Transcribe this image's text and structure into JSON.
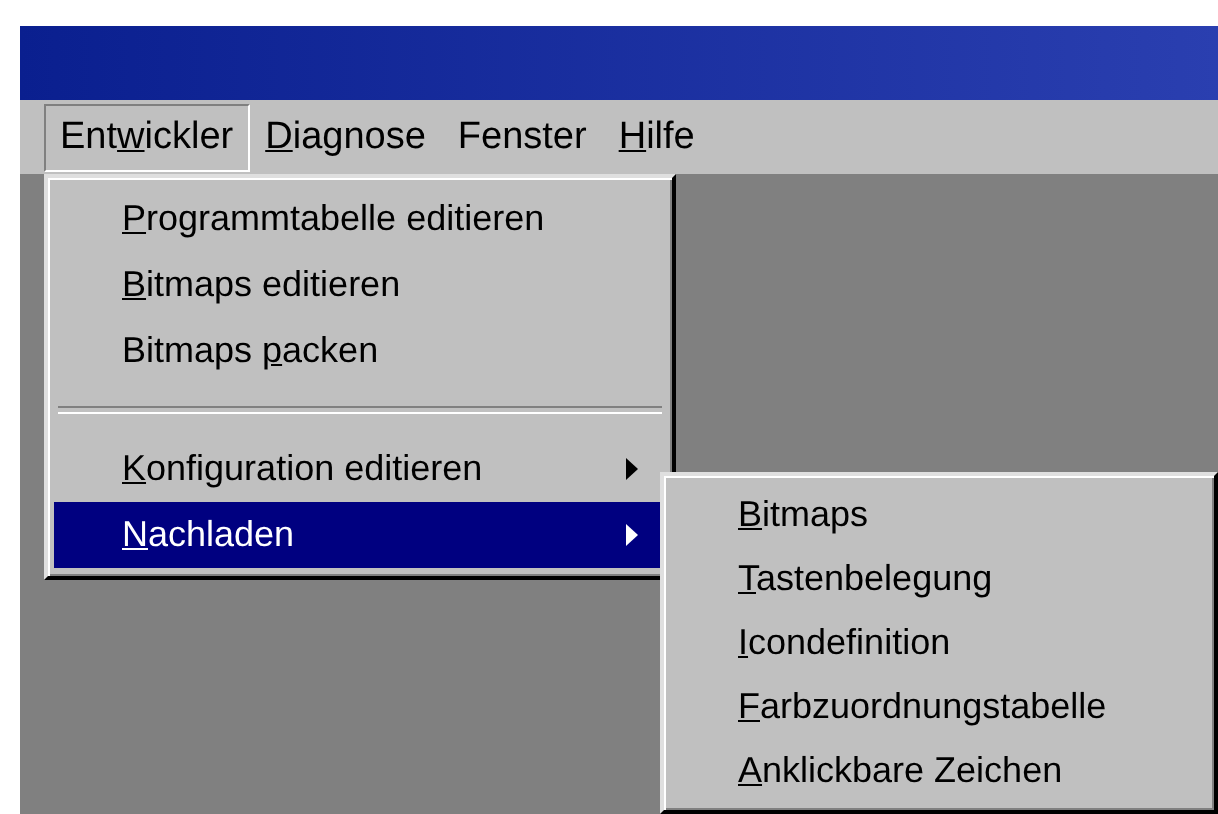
{
  "menu_bar": [
    {
      "pre": "Ent",
      "key": "w",
      "post": "ickler",
      "open": true
    },
    {
      "key": "D",
      "post": "iagnose",
      "open": false
    },
    {
      "pre": "Fenster",
      "open": false
    },
    {
      "key": "H",
      "post": "ilfe",
      "open": false
    }
  ],
  "dropdown": [
    {
      "kind": "item",
      "key": "P",
      "post": "rogrammtabelle editieren",
      "selected": false
    },
    {
      "kind": "item",
      "key": "B",
      "post": "itmaps editieren",
      "selected": false
    },
    {
      "kind": "item",
      "pre": "Bitmaps ",
      "key": "p",
      "post": "acken",
      "selected": false
    },
    {
      "kind": "separator"
    },
    {
      "kind": "item",
      "key": "K",
      "post": "onfiguration editieren",
      "submenu": true,
      "selected": false
    },
    {
      "kind": "item",
      "key": "N",
      "post": "achladen",
      "submenu": true,
      "selected": true
    }
  ],
  "submenu": [
    {
      "key": "B",
      "post": "itmaps"
    },
    {
      "key": "T",
      "post": "astenbelegung"
    },
    {
      "key": "I",
      "post": "condefinition"
    },
    {
      "key": "F",
      "post": "arbzuordnungstabelle"
    },
    {
      "key": "A",
      "post": "nklickbare Zeichen"
    }
  ]
}
